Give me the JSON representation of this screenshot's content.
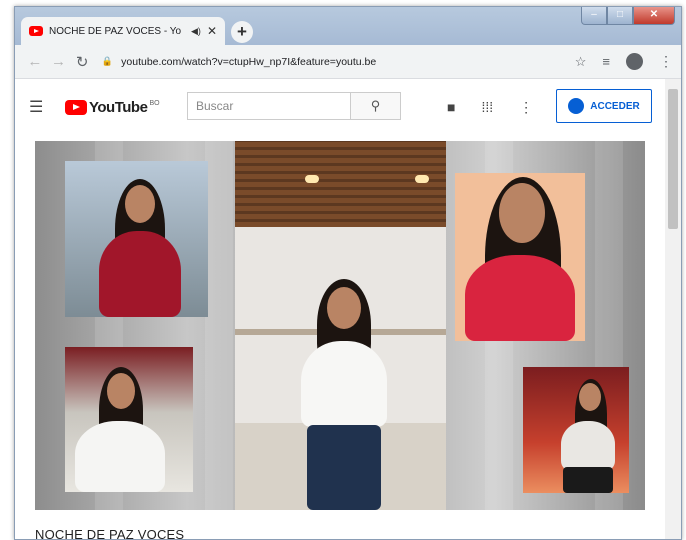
{
  "browser": {
    "tab_title": "NOCHE DE PAZ VOCES - Yo",
    "new_tab": "+",
    "window_controls": {
      "minimize": "",
      "maximize": "",
      "close": ""
    },
    "back": "←",
    "forward": "→",
    "reload": "↻",
    "url": "youtube.com/watch?v=ctupHw_np7I&feature=youtu.be"
  },
  "youtube": {
    "logo_text": "YouTube",
    "country_code": "BO",
    "search_placeholder": "Buscar",
    "signin_label": "ACCEDER"
  },
  "video": {
    "title": "NOCHE DE PAZ VOCES"
  }
}
